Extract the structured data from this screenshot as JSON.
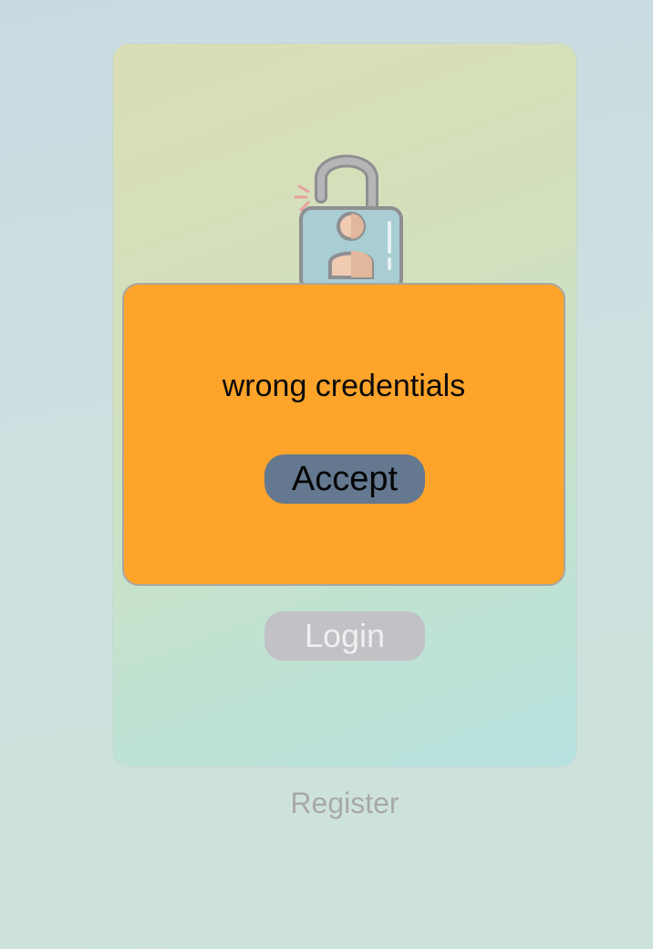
{
  "login_card": {
    "login_label": "Login"
  },
  "register_label": "Register",
  "icons": {
    "lock": "unlocked-padlock-user-icon"
  },
  "dialog": {
    "message": "wrong credentials",
    "accept_label": "Accept"
  },
  "colors": {
    "dialog_background": "#ffa42a",
    "accept_button": "#647890",
    "login_button": "#c2c0c6",
    "register_text": "#a9a9a9"
  }
}
